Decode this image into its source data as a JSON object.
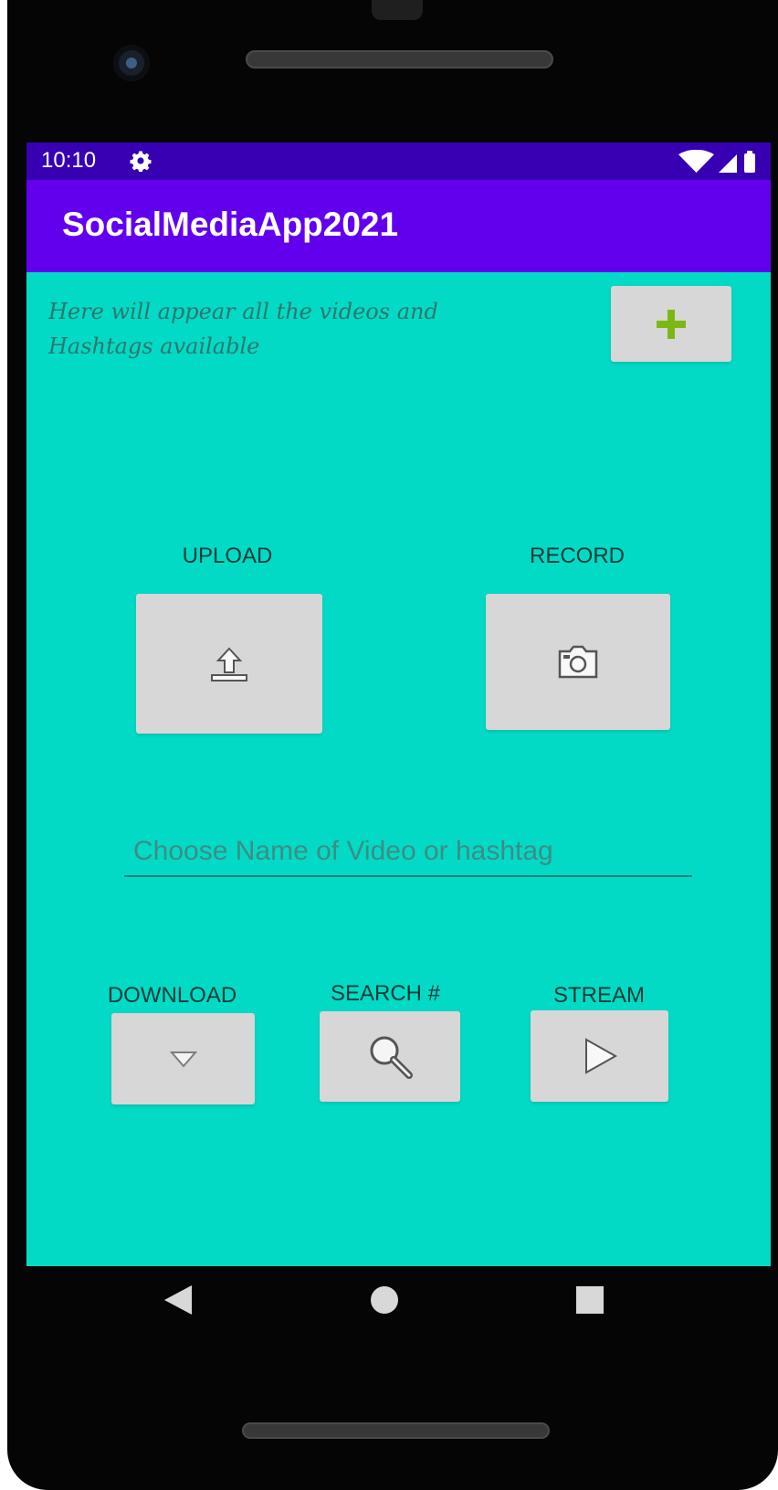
{
  "status_bar": {
    "time": "10:10",
    "settings_icon": "gear-icon",
    "wifi_icon": "wifi-icon",
    "signal_icon": "cell-signal-icon",
    "battery_icon": "battery-icon"
  },
  "app_bar": {
    "title": "SocialMediaApp2021"
  },
  "content": {
    "description": "Here will appear all the videos and Hashtags available",
    "add_button_icon": "plus-icon",
    "upload_label": "UPLOAD",
    "upload_icon": "upload-icon",
    "record_label": "RECORD",
    "record_icon": "camera-icon",
    "name_input_placeholder": "Choose Name of Video or hashtag",
    "name_input_value": "",
    "download_label": "DOWNLOAD",
    "download_icon": "chevron-down-icon",
    "search_label": "SEARCH #",
    "search_icon": "search-icon",
    "stream_label": "STREAM",
    "stream_icon": "play-icon"
  },
  "navigation": {
    "back_icon": "back-triangle-icon",
    "home_icon": "home-circle-icon",
    "recents_icon": "recents-square-icon"
  },
  "colors": {
    "status_bar": "#3700b3",
    "app_bar": "#6200ee",
    "content_background": "#03dac5",
    "button_background": "#d7d7d7",
    "plus_icon": "#7cb814",
    "label_text": "#0d3b35",
    "input_underline": "#1f7e74"
  }
}
